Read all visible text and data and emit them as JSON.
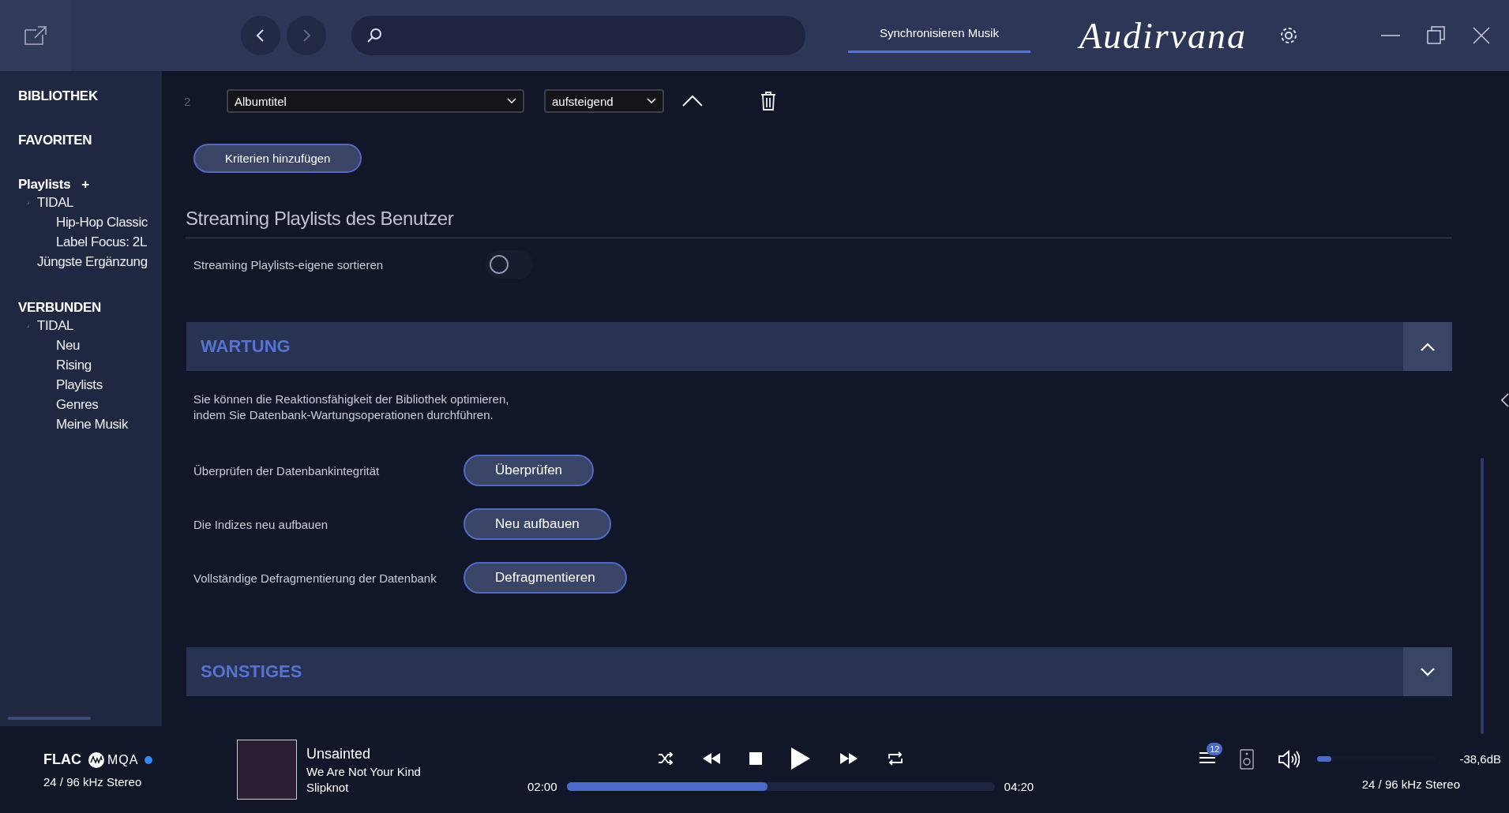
{
  "toolbar": {
    "tabs": [
      {
        "label": "Synchronisieren Musik",
        "selected": true
      }
    ],
    "logo": "Audirvana"
  },
  "sidebar": {
    "sections": [
      {
        "label": "BIBLIOTHEK",
        "kind": "header"
      },
      {
        "label": "FAVORITEN",
        "kind": "header"
      },
      {
        "label": "Playlists",
        "kind": "playlists",
        "add": "+",
        "children": [
          {
            "label": "TIDAL",
            "expanded": true,
            "children": [
              {
                "label": "Hip-Hop Classic"
              },
              {
                "label": "Label Focus: 2L"
              }
            ]
          },
          {
            "label": "Jüngste Ergänzung"
          }
        ]
      },
      {
        "label": "VERBUNDEN",
        "kind": "header",
        "children": [
          {
            "label": "TIDAL",
            "expanded": true,
            "children": [
              {
                "label": "Neu"
              },
              {
                "label": "Rising"
              },
              {
                "label": "Playlists"
              },
              {
                "label": "Genres"
              },
              {
                "label": "Meine Musik"
              }
            ]
          }
        ]
      }
    ]
  },
  "sort_criteria": [
    {
      "index": "2",
      "field": "Albumtitel",
      "order": "aufsteigend"
    }
  ],
  "add_criteria_button": "Kriterien hinzufügen",
  "streaming_section": {
    "title": "Streaming Playlists des Benutzer",
    "option": {
      "label": "Streaming Playlists-eigene sortieren",
      "on": false
    }
  },
  "panels": [
    {
      "title": "WARTUNG",
      "expanded": true,
      "description": [
        "Sie können die Reaktionsfähigkeit der Bibliothek optimieren,",
        "indem Sie Datenbank-Wartungsoperationen durchführen."
      ],
      "actions": [
        {
          "label": "Überprüfen der Datenbankintegrität",
          "button": "Überprüfen"
        },
        {
          "label": "Die Indizes neu aufbauen",
          "button": "Neu aufbauen"
        },
        {
          "label": "Vollständige Defragmentierung der Datenbank",
          "button": "Defragmentieren"
        }
      ]
    },
    {
      "title": "SONSTIGES",
      "expanded": false
    }
  ],
  "player": {
    "format": "FLAC",
    "badge": "MQA",
    "source_format": "24 / 96 kHz Stereo",
    "track": {
      "title": "Unsainted",
      "album": "We Are Not Your Kind",
      "artist": "Slipknot"
    },
    "elapsed": "02:00",
    "duration": "04:20",
    "progress": {
      "level": 0.47
    },
    "queue_count": "12",
    "volume": {
      "level": 0.12
    },
    "volume_reading": "-38,6dB",
    "output_format": "24 / 96 kHz Stereo"
  }
}
